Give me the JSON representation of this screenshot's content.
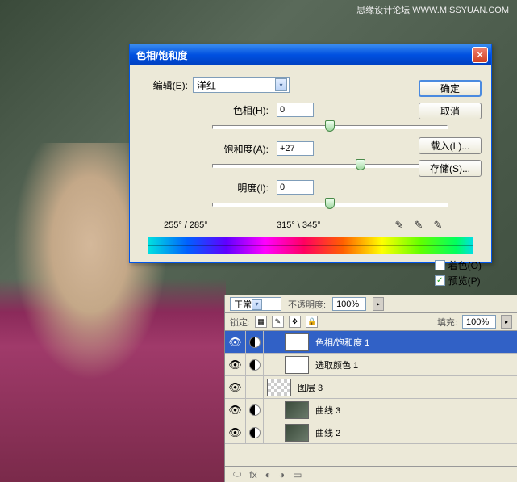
{
  "watermark": "思缘设计论坛  WWW.MISSYUAN.COM",
  "dialog": {
    "title": "色相/饱和度",
    "edit_label": "编辑(E):",
    "edit_value": "洋红",
    "hue": {
      "label": "色相(H):",
      "value": "0",
      "pos": 50
    },
    "saturation": {
      "label": "饱和度(A):",
      "value": "+27",
      "pos": 63
    },
    "lightness": {
      "label": "明度(I):",
      "value": "0",
      "pos": 50
    },
    "angle_left": "255° / 285°",
    "angle_right": "315° \\ 345°",
    "buttons": {
      "ok": "确定",
      "cancel": "取消",
      "load": "载入(L)...",
      "save": "存储(S)..."
    },
    "colorize": {
      "label": "着色(O)",
      "checked": false
    },
    "preview": {
      "label": "预览(P)",
      "checked": true
    }
  },
  "layers": {
    "blend_mode": "正常",
    "opacity_label": "不透明度:",
    "opacity_value": "100%",
    "lock_label": "锁定:",
    "fill_label": "填充:",
    "fill_value": "100%",
    "items": [
      {
        "name": "色相/饱和度 1",
        "selected": true,
        "type": "adj-hs"
      },
      {
        "name": "选取颜色 1",
        "selected": false,
        "type": "adj-sc"
      },
      {
        "name": "图层 3",
        "selected": false,
        "type": "layer"
      },
      {
        "name": "曲线 3",
        "selected": false,
        "type": "adj-curve"
      },
      {
        "name": "曲线 2",
        "selected": false,
        "type": "adj-curve"
      }
    ]
  }
}
